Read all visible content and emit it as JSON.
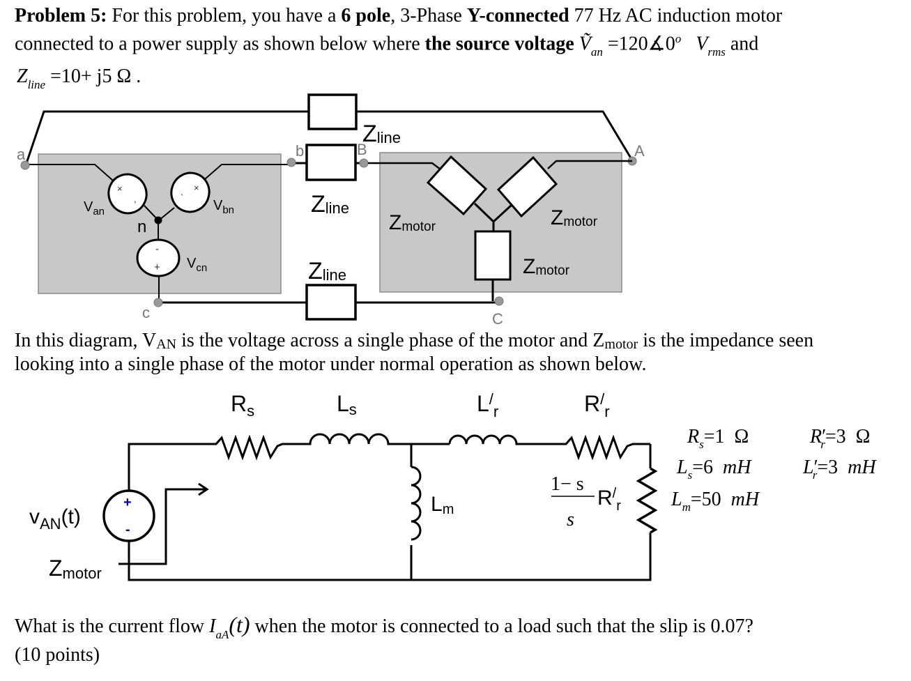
{
  "problem": {
    "line1": {
      "label": "Problem 5:",
      "t1": " For this problem, you have a ",
      "poles": "6 pole",
      "t2": ", 3-Phase ",
      "conn": "Y-connected",
      "t3": " 77 Hz AC induction motor"
    },
    "line2": {
      "t1": "connected to a power supply as shown below where ",
      "bold": "the source voltage",
      "v_symbol": "Ṽ",
      "v_sub": "an",
      "v_value": "=120∡0",
      "deg": "o",
      "unit": "V",
      "unit_sub": "rms",
      "t2": "and"
    },
    "line3": {
      "z_symbol": "Z",
      "z_sub": "line",
      "z_value": "=10+ j5  Ω ."
    }
  },
  "diagram1": {
    "nodes": {
      "a": "a",
      "b": "b",
      "c": "c",
      "n": "n",
      "A": "A",
      "B": "B",
      "C": "C"
    },
    "sources": [
      {
        "label": "V",
        "sub": "an"
      },
      {
        "label": "V",
        "sub": "bn"
      },
      {
        "label": "V",
        "sub": "cn"
      }
    ],
    "source_marks": {
      "plus": "+",
      "minus": "-",
      "cross": "×"
    },
    "zline": {
      "label": "Z",
      "sub": "line"
    },
    "zmotor": {
      "label": "Z",
      "sub": "motor"
    }
  },
  "explanation": {
    "t1": "In this diagram, V",
    "van_sub": "AN",
    "t2": " is the voltage across a single phase of the motor and Z",
    "zm_sub": "motor",
    "t3": " is the impedance seen",
    "line2": "looking into a single phase of the motor under normal operation as shown below."
  },
  "diagram2": {
    "Rs": {
      "label": "R",
      "sub": "s"
    },
    "Ls": {
      "label": "L",
      "sub": "s"
    },
    "Lr": {
      "label": "L",
      "prime": "/",
      "sub": "r"
    },
    "Rr": {
      "label": "R",
      "prime": "/",
      "sub": "r"
    },
    "Lm": {
      "label": "L",
      "sub": "m"
    },
    "load": {
      "num": "1− s",
      "den": "s",
      "label": "R",
      "prime": "/",
      "sub": "r"
    },
    "source": {
      "label": "v",
      "sub": "AN",
      "suffix": "(t)",
      "plus": "+",
      "minus": "-"
    },
    "zmotor": {
      "label": "Z",
      "sub": "motor"
    },
    "source_sign_color": "#0000cc"
  },
  "parameters": [
    {
      "sym": "R",
      "sub": "s",
      "prime": "",
      "value": "=1",
      "unit": "Ω"
    },
    {
      "sym": "R",
      "sub": "r",
      "prime": "′",
      "value": "=3",
      "unit": "Ω"
    },
    {
      "sym": "L",
      "sub": "s",
      "prime": "",
      "value": "=6",
      "unit": "mH"
    },
    {
      "sym": "L",
      "sub": "r",
      "prime": "′",
      "value": "=3",
      "unit": "mH"
    },
    {
      "sym": "L",
      "sub": "m",
      "prime": "",
      "value": "=50",
      "unit": "mH"
    }
  ],
  "question": {
    "t1": "What is the current flow ",
    "i_sym": "I",
    "i_sub": "aA",
    "i_arg": "(t)",
    "t2": " when the motor is connected to a load such that the slip is 0.07?",
    "points": "(10 points)"
  }
}
